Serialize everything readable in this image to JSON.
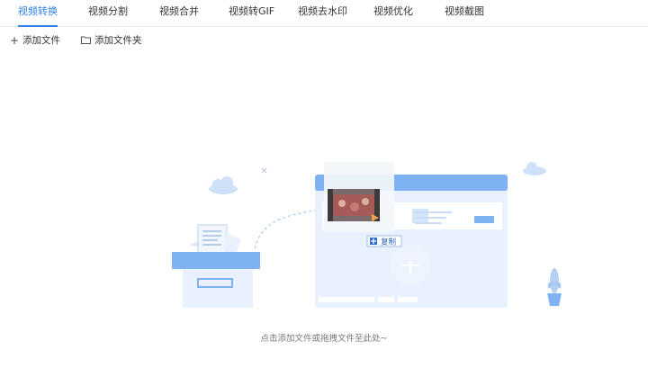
{
  "tabs": [
    {
      "label": "视频转换",
      "active": true
    },
    {
      "label": "视频分割",
      "active": false
    },
    {
      "label": "视频合并",
      "active": false
    },
    {
      "label": "视频转GIF",
      "active": false
    },
    {
      "label": "视频去水印",
      "active": false
    },
    {
      "label": "视频优化",
      "active": false
    },
    {
      "label": "视频截图",
      "active": false
    }
  ],
  "toolbar": {
    "add_file": {
      "label": "添加文件",
      "icon": "plus-icon"
    },
    "add_folder": {
      "label": "添加文件夹",
      "icon": "folder-icon"
    }
  },
  "drop_zone": {
    "copy_badge": "复制",
    "hint": "点击添加文件或拖拽文件至此处~"
  },
  "colors": {
    "accent": "#2f80ed",
    "illustration_blue": "#7fb2f3",
    "illustration_light": "#e8f1fd"
  }
}
